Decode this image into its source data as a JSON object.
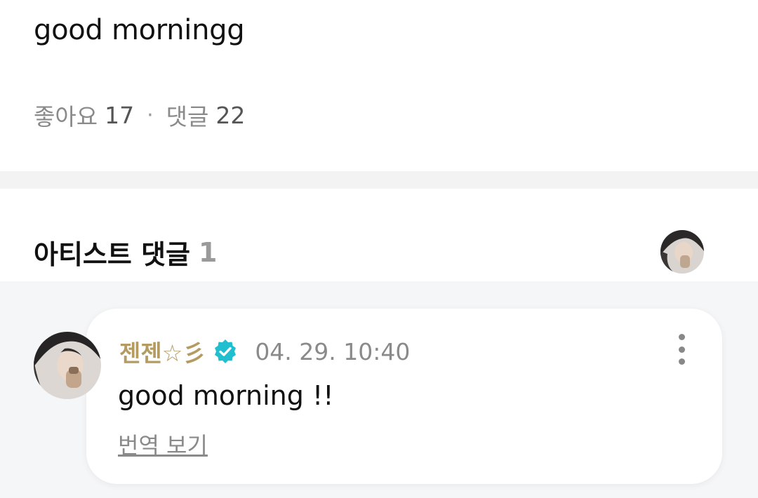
{
  "post": {
    "text": "good morningg",
    "likes_label": "좋아요",
    "likes_count": "17",
    "separator": "·",
    "comments_label": "댓글",
    "comments_count": "22"
  },
  "artist_comments": {
    "title": "아티스트 댓글",
    "count": "1"
  },
  "comment": {
    "author": "젠젠☆彡",
    "verified_icon": "verified-badge-icon",
    "time": "04. 29. 10:40",
    "text": "good morning !!",
    "translate_label": "번역 보기",
    "more_icon": "more-vertical-icon"
  },
  "colors": {
    "author": "#b39b62",
    "verified": "#1fbfcf",
    "comment_area_bg": "#f4f6f8",
    "divider": "#f3f3f3"
  }
}
